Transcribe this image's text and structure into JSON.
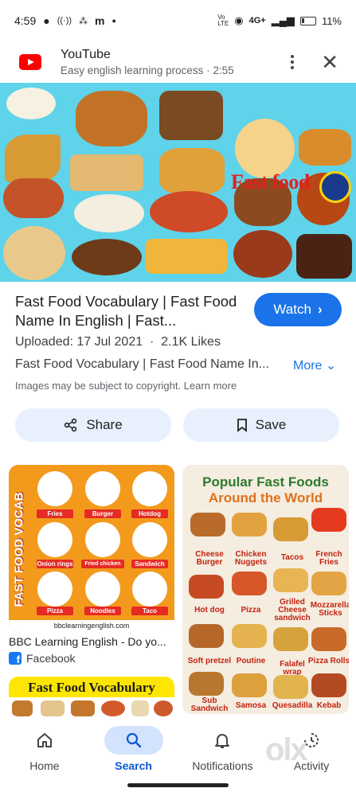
{
  "status_bar": {
    "time": "4:59",
    "network": "4G+",
    "battery": "11%"
  },
  "header": {
    "app_name": "YouTube",
    "subtitle": "Easy english learning process · 2:55",
    "icons": [
      "youtube-logo-icon",
      "more-vert-icon",
      "close-icon"
    ]
  },
  "hero": {
    "title": "Fast food"
  },
  "result": {
    "title": "Fast Food Vocabulary | Fast Food Name In English | Fast...",
    "watch_label": "Watch",
    "meta": "Uploaded: 17 Jul 2021  ·  2.1K Likes",
    "description": "Fast Food Vocabulary | Fast Food Name In...",
    "more_label": "More",
    "copyright": "Images may be subject to copyright. Learn more",
    "share_label": "Share",
    "save_label": "Save"
  },
  "related": {
    "item1": {
      "side_text": "FAST FOOD VOCAB",
      "labels": [
        "Fries",
        "Burger",
        "Hotdog",
        "Onion rings",
        "Fried chicken",
        "Sandwich",
        "Pizza",
        "Noodles",
        "Taco"
      ],
      "footer": "bbclearningenglish.com",
      "title": "BBC Learning English - Do yo...",
      "source": "Facebook"
    },
    "item2": {
      "title_line1": "Popular Fast Foods",
      "title_line2": "Around the World",
      "labels": [
        "Cheese Burger",
        "Chicken Nuggets",
        "Tacos",
        "French Fries",
        "Hot dog",
        "Pizza",
        "Grilled Cheese sandwich",
        "Mozzarella Sticks",
        "Soft pretzel",
        "Poutine",
        "Falafel wrap",
        "Pizza Rolls",
        "Sub Sandwich",
        "Samosa",
        "Quesadilla",
        "Kebab"
      ]
    },
    "item3": {
      "title": "Fast Food Vocabulary"
    }
  },
  "bottom_nav": {
    "items": [
      {
        "label": "Home"
      },
      {
        "label": "Search"
      },
      {
        "label": "Notifications"
      },
      {
        "label": "Activity"
      }
    ]
  },
  "colors": {
    "accent": "#1a73e8",
    "youtube_red": "#ff0000",
    "hero_bg": "#5ed3ea",
    "pill_bg": "#e8f0fe"
  }
}
